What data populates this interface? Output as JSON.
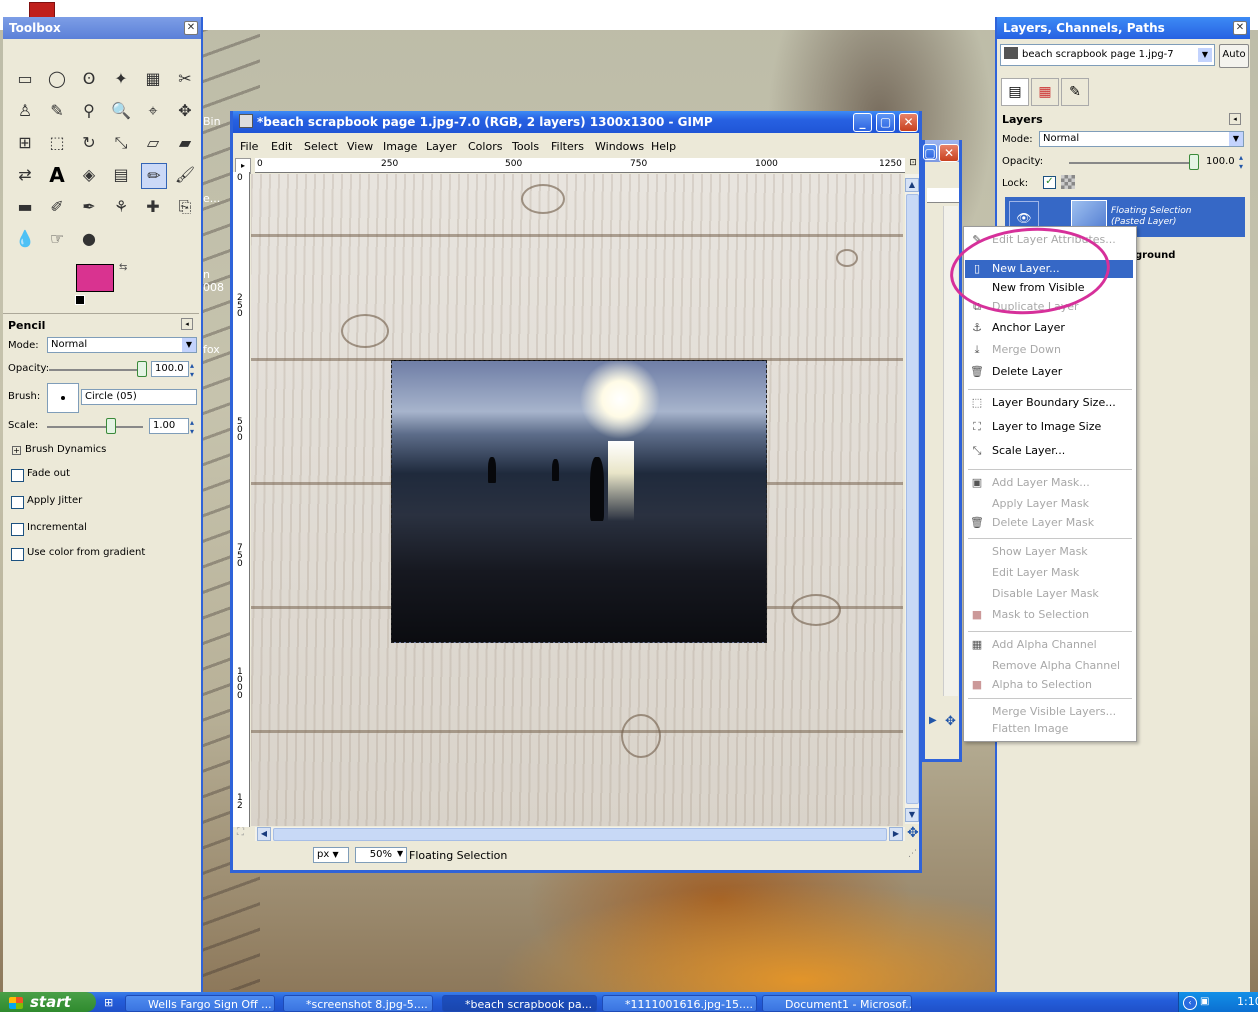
{
  "desktop": {
    "side_text": [
      "Bin",
      "e...",
      "n",
      "008",
      "fox"
    ]
  },
  "toolbox": {
    "title": "Toolbox",
    "tool_icons": [
      "rect-select-icon",
      "ellipse-select-icon",
      "free-select-icon",
      "fuzzy-select-icon",
      "color-select-icon",
      "scissors-icon",
      "foreground-select-icon",
      "paths-icon",
      "color-picker-icon",
      "zoom-icon",
      "measure-icon",
      "move-icon",
      "align-icon",
      "crop-icon",
      "rotate-icon",
      "scale-icon",
      "shear-icon",
      "perspective-icon",
      "flip-icon",
      "text-icon",
      "bucket-fill-icon",
      "blend-icon",
      "pencil-icon",
      "paintbrush-icon",
      "eraser-icon",
      "airbrush-icon",
      "ink-icon",
      "clone-icon",
      "heal-icon",
      "perspective-clone-icon",
      "blur-icon",
      "smudge-icon",
      "dodge-burn-icon"
    ],
    "fg_color": "#d93390",
    "bg_color": "#ffffff",
    "options": {
      "title": "Pencil",
      "mode_label": "Mode:",
      "mode_value": "Normal",
      "opacity_label": "Opacity:",
      "opacity_value": "100.0",
      "brush_label": "Brush:",
      "brush_value": "Circle (05)",
      "scale_label": "Scale:",
      "scale_value": "1.00",
      "brush_dynamics": "Brush Dynamics",
      "checkboxes": [
        "Fade out",
        "Apply Jitter",
        "Incremental",
        "Use color from gradient"
      ]
    }
  },
  "image_window": {
    "title": "*beach scrapbook page 1.jpg-7.0 (RGB, 2 layers) 1300x1300 - GIMP",
    "menu": [
      "File",
      "Edit",
      "Select",
      "View",
      "Image",
      "Layer",
      "Colors",
      "Tools",
      "Filters",
      "Windows",
      "Help"
    ],
    "hruler": [
      "0",
      "250",
      "500",
      "750",
      "1000",
      "1250"
    ],
    "vruler": [
      "0",
      "2\n5\n0",
      "5\n0\n0",
      "7\n5\n0",
      "1\n0\n0\n0",
      "1\n2"
    ],
    "unit": "px",
    "zoom": "50%",
    "status": "Floating Selection"
  },
  "layers_dock": {
    "title": "Layers, Channels, Paths",
    "image_select": "beach scrapbook page 1.jpg-7",
    "auto_button": "Auto",
    "tab_icons": [
      "layers-tab-icon",
      "channels-tab-icon",
      "paths-tab-icon"
    ],
    "section": "Layers",
    "mode_label": "Mode:",
    "mode_value": "Normal",
    "opacity_label": "Opacity:",
    "opacity_value": "100.0",
    "lock_label": "Lock:",
    "layers": [
      {
        "name": "Floating Selection",
        "sub": "(Pasted Layer)"
      },
      {
        "name": "ground",
        "sub": ""
      }
    ]
  },
  "context_menu": {
    "items": [
      {
        "label": "Edit Layer Attributes...",
        "disabled": true,
        "icon": "edit-attributes-icon"
      },
      {
        "label": "New Layer...",
        "disabled": false,
        "icon": "new-layer-icon",
        "highlighted": true
      },
      {
        "label": "New from Visible",
        "disabled": false,
        "icon": ""
      },
      {
        "label": "Duplicate Layer",
        "disabled": true,
        "icon": "duplicate-layer-icon"
      },
      {
        "label": "Anchor Layer",
        "disabled": false,
        "icon": "anchor-icon"
      },
      {
        "label": "Merge Down",
        "disabled": true,
        "icon": "merge-down-icon"
      },
      {
        "label": "Delete Layer",
        "disabled": false,
        "icon": "delete-icon"
      },
      {
        "label": "Layer Boundary Size...",
        "disabled": false,
        "icon": "boundary-size-icon"
      },
      {
        "label": "Layer to Image Size",
        "disabled": false,
        "icon": "to-image-size-icon"
      },
      {
        "label": "Scale Layer...",
        "disabled": false,
        "icon": "scale-layer-icon"
      },
      {
        "label": "Add Layer Mask...",
        "disabled": true,
        "icon": "add-mask-icon"
      },
      {
        "label": "Apply Layer Mask",
        "disabled": true,
        "icon": ""
      },
      {
        "label": "Delete Layer Mask",
        "disabled": true,
        "icon": "delete-mask-icon"
      },
      {
        "label": "Show Layer Mask",
        "disabled": true,
        "icon": ""
      },
      {
        "label": "Edit Layer Mask",
        "disabled": true,
        "icon": ""
      },
      {
        "label": "Disable Layer Mask",
        "disabled": true,
        "icon": ""
      },
      {
        "label": "Mask to Selection",
        "disabled": true,
        "icon": "mask-to-selection-icon"
      },
      {
        "label": "Add Alpha Channel",
        "disabled": true,
        "icon": "add-alpha-icon"
      },
      {
        "label": "Remove Alpha Channel",
        "disabled": true,
        "icon": ""
      },
      {
        "label": "Alpha to Selection",
        "disabled": true,
        "icon": "alpha-to-selection-icon"
      },
      {
        "label": "Merge Visible Layers...",
        "disabled": true,
        "icon": ""
      },
      {
        "label": "Flatten Image",
        "disabled": true,
        "icon": ""
      }
    ]
  },
  "taskbar": {
    "start": "start",
    "tasks": [
      "Wells Fargo Sign Off ...",
      "*screenshot 8.jpg-5....",
      "*beach scrapbook pa...",
      "*1111001616.jpg-15....",
      "Document1 - Microsof..."
    ],
    "clock": "1:10"
  }
}
